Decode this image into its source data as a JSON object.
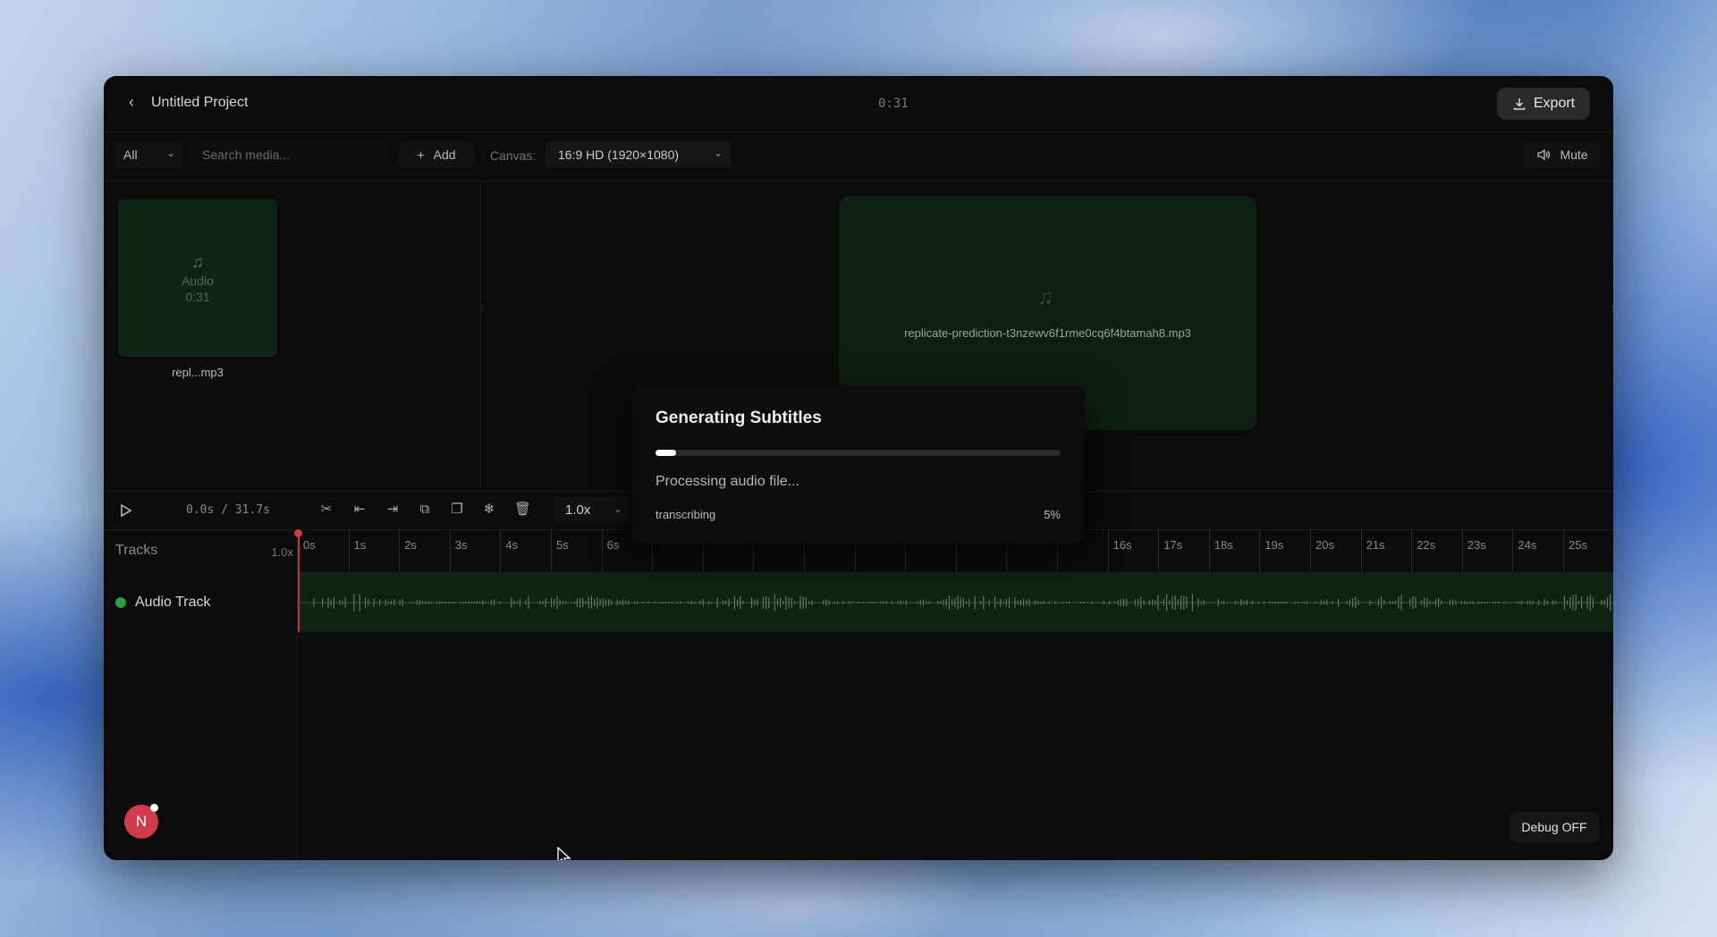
{
  "header": {
    "back_icon": "chevron-left-icon",
    "project_title": "Untitled Project",
    "duration": "0:31",
    "export_label": "Export",
    "export_icon": "download-icon"
  },
  "toolbar": {
    "filter_value": "All",
    "search_placeholder": "Search media...",
    "add_label": "Add",
    "canvas_label": "Canvas:",
    "canvas_value": "16:9 HD (1920×1080)",
    "mute_label": "Mute",
    "mute_icon": "speaker-icon"
  },
  "media": {
    "items": [
      {
        "kind": "Audio",
        "duration": "0:31",
        "name": "repl...mp3",
        "icon": "music-note-icon"
      }
    ]
  },
  "preview": {
    "file_name": "replicate-prediction-t3nzewv6f1rme0cq6f4btamah8.mp3",
    "icon": "music-note-icon"
  },
  "modal": {
    "title": "Generating Subtitles",
    "status": "Processing audio file...",
    "stage": "transcribing",
    "progress_percent": 5,
    "progress_label": "5%"
  },
  "timeline": {
    "time_readout": "0.0s / 31.7s",
    "tools": [
      "scissors-icon",
      "trim-start-icon",
      "trim-end-icon",
      "split-icon",
      "duplicate-icon",
      "freeze-icon",
      "trash-icon"
    ],
    "speed": "1.0x",
    "tracks_label": "Tracks",
    "zoom_label": "1.0x",
    "ticks": [
      "0s",
      "1s",
      "2s",
      "3s",
      "4s",
      "5s",
      "6s",
      "",
      "",
      "",
      "",
      "",
      "",
      "",
      "",
      "",
      "16s",
      "17s",
      "18s",
      "19s",
      "20s",
      "21s",
      "22s",
      "23s",
      "24s",
      "25s"
    ],
    "tracks": [
      {
        "name": "Audio Track",
        "color": "#2e9a48"
      }
    ]
  },
  "footer": {
    "avatar_letter": "N",
    "debug_label": "Debug OFF"
  },
  "colors": {
    "window_bg": "#0b0b0b",
    "track_fill": "#0d2413",
    "playhead": "#c0303a",
    "avatar": "#d13a4c"
  }
}
